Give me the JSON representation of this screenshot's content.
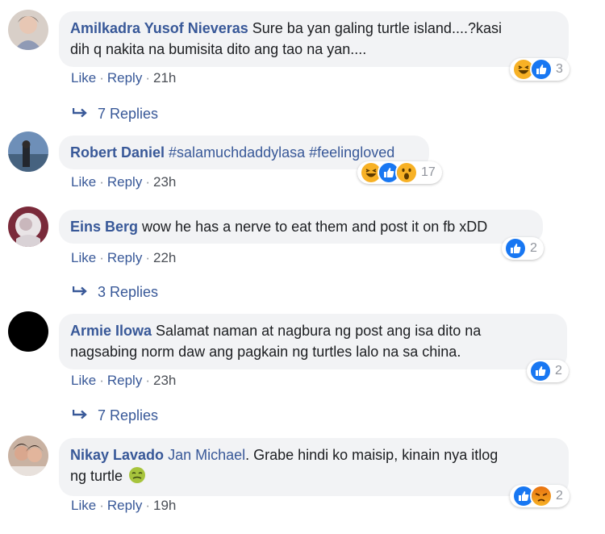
{
  "actions": {
    "like": "Like",
    "reply": "Reply",
    "dot": "·"
  },
  "comments": [
    {
      "author": "Amilkadra Yusof Nieveras",
      "text_line1": "Sure ba yan galing turtle island....?kasi",
      "text_line2": "dih q nakita na bumisita dito ang tao na yan....",
      "time": "21h",
      "reactions": [
        "haha",
        "like"
      ],
      "reaction_count": "3",
      "replies": "7 Replies"
    },
    {
      "author": "Robert Daniel",
      "text": "#salamuchdaddylasa #feelingloved",
      "time": "23h",
      "reactions": [
        "haha",
        "like",
        "wow"
      ],
      "reaction_count": "17"
    },
    {
      "author": "Eins Berg",
      "text": "wow he has a nerve to eat them and post it on fb xDD",
      "time": "22h",
      "reactions": [
        "like"
      ],
      "reaction_count": "2",
      "replies": "3 Replies"
    },
    {
      "author": "Armie Ilowa",
      "text_line1": "Salamat naman at nagbura ng post ang isa dito na",
      "text_line2": "nagsabing norm daw ang pagkain ng turtles lalo na sa china.",
      "time": "23h",
      "reactions": [
        "like"
      ],
      "reaction_count": "2",
      "replies": "7 Replies"
    },
    {
      "author": "Nikay Lavado",
      "mention": "Jan Michael",
      "text_line1": ". Grabe hindi ko maisip, kinain nya itlog",
      "text_line2": "ng turtle",
      "emoji": "nauseated-face",
      "time": "19h",
      "reactions": [
        "like",
        "angry"
      ],
      "reaction_count": "2"
    }
  ],
  "colors": {
    "link": "#385898",
    "bubble": "#f2f3f5",
    "like": "#1877f2",
    "haha": "#f7b125",
    "angry": "#e9710f"
  }
}
